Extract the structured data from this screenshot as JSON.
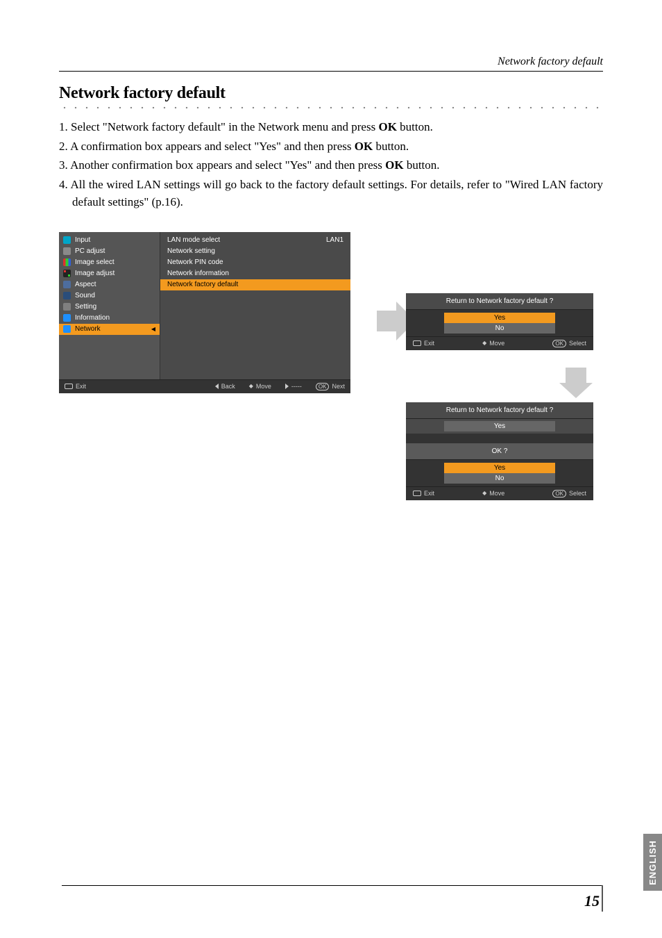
{
  "header": {
    "breadcrumb": "Network factory default"
  },
  "title": "Network factory default",
  "steps": [
    {
      "pre": "Select \"Network factory default\" in the Network menu and press ",
      "bold": "OK",
      "post": " button."
    },
    {
      "pre": "A confirmation box appears and select \"Yes\" and then press ",
      "bold": "OK",
      "post": " button."
    },
    {
      "pre": "Another confirmation box appears and select \"Yes\" and then press ",
      "bold": "OK",
      "post": " button."
    },
    {
      "pre": "All the wired LAN settings will go back to the factory default settings. For details, refer to \"Wired LAN factory default settings\" (p.16).",
      "bold": "",
      "post": ""
    }
  ],
  "osd": {
    "sidebar": [
      {
        "label": "Input",
        "icon": "ico-input"
      },
      {
        "label": "PC adjust",
        "icon": "ico-pc"
      },
      {
        "label": "Image select",
        "icon": "ico-imgsel"
      },
      {
        "label": "Image adjust",
        "icon": "ico-imgadj"
      },
      {
        "label": "Aspect",
        "icon": "ico-aspect"
      },
      {
        "label": "Sound",
        "icon": "ico-sound"
      },
      {
        "label": "Setting",
        "icon": "ico-setting"
      },
      {
        "label": "Information",
        "icon": "ico-info"
      },
      {
        "label": "Network",
        "icon": "ico-net",
        "selected": true
      }
    ],
    "submenu": [
      {
        "label": "LAN mode select",
        "value": "LAN1"
      },
      {
        "label": "Network setting"
      },
      {
        "label": "Network PIN code"
      },
      {
        "label": "Network information"
      },
      {
        "label": "Network factory default",
        "selected": true
      }
    ],
    "footer": {
      "exit": "Exit",
      "back": "Back",
      "move": "Move",
      "dashes": "-----",
      "next": "Next",
      "ok": "OK"
    }
  },
  "dialog1": {
    "question": "Return to Network factory default ?",
    "options": [
      "Yes",
      "No"
    ],
    "selected": "Yes",
    "footer": {
      "exit": "Exit",
      "move": "Move",
      "ok": "OK",
      "select": "Select"
    }
  },
  "dialog2": {
    "question": "Return to Network factory default ?",
    "answer": "Yes",
    "confirm_label": "OK ?",
    "options": [
      "Yes",
      "No"
    ],
    "selected": "Yes",
    "footer": {
      "exit": "Exit",
      "move": "Move",
      "ok": "OK",
      "select": "Select"
    }
  },
  "side_tab": "ENGLISH",
  "page_number": "15"
}
